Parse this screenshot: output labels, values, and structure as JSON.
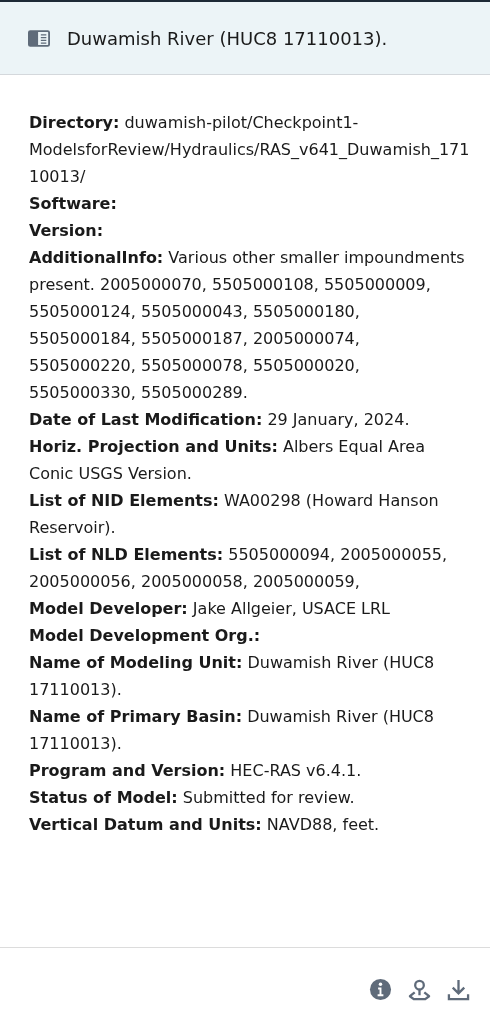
{
  "header": {
    "title": "Duwamish River (HUC8 17110013)."
  },
  "fields": [
    {
      "label": "Directory:",
      "value": "duwamish-pilot/Checkpoint1-ModelsforReview/Hydraulics/RAS_v641_Duwamish_17110013/"
    },
    {
      "label": "Software:"
    },
    {
      "label": "Version:"
    },
    {
      "label": "AdditionalInfo:",
      "value": "Various other smaller impoundments present. 2005000070, 5505000108, 5505000009, 5505000124, 5505000043, 5505000180, 5505000184, 5505000187, 2005000074, 5505000220, 5505000078, 5505000020, 5505000330, 5505000289."
    },
    {
      "label": "Date of Last Modification:",
      "value": "29 January, 2024."
    },
    {
      "label": "Horiz. Projection and Units:",
      "value": "Albers Equal Area Conic USGS Version."
    },
    {
      "label": "List of NID Elements:",
      "value": "WA00298 (Howard Hanson Reservoir)."
    },
    {
      "label": "List of NLD Elements:",
      "value": "5505000094, 2005000055, 2005000056, 2005000058, 2005000059,"
    },
    {
      "label": "Model Developer:",
      "value": "Jake Allgeier, USACE LRL"
    },
    {
      "label": "Model Development Org.:"
    },
    {
      "label": "Name of Modeling Unit:",
      "value": "Duwamish River (HUC8 17110013)."
    },
    {
      "label": "Name of Primary Basin:",
      "value": "Duwamish River (HUC8 17110013)."
    },
    {
      "label": "Program and Version:",
      "value": "HEC-RAS v6.4.1."
    },
    {
      "label": "Status of Model:",
      "value": "Submitted for review."
    },
    {
      "label": "Vertical Datum and Units:",
      "value": "NAVD88, feet."
    }
  ],
  "actions": [
    {
      "kind": "info"
    },
    {
      "kind": "locate"
    },
    {
      "kind": "download"
    }
  ]
}
